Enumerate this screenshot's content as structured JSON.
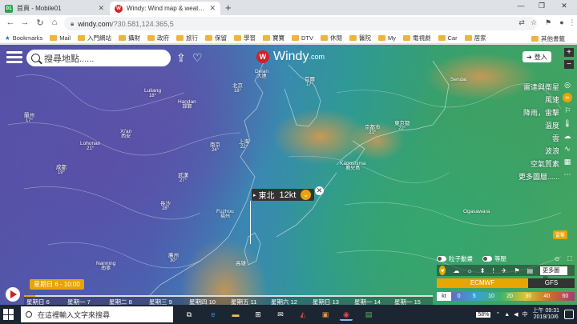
{
  "browser": {
    "tabs": [
      {
        "title": "首頁 - Mobile01",
        "favicon": "mobile01-icon",
        "active": false
      },
      {
        "title": "Windy: Wind map & weather fo",
        "favicon": "windy-icon",
        "active": true
      }
    ],
    "new_tab": "+",
    "url_host": "windy.com",
    "url_path": "/?30.581,124.365,5",
    "bookmarks": [
      "Bookmarks",
      "Mail",
      "入門網站",
      "攝財",
      "政府",
      "旅行",
      "保留",
      "學習",
      "寶寶",
      "DTV",
      "休閒",
      "醫院",
      "My",
      "電視劇",
      "Car",
      "居家"
    ],
    "other_bookmarks": "其他書籤"
  },
  "windy": {
    "search_placeholder": "搜尋地點......",
    "logo_text": "Windy",
    "logo_suffix": ".com",
    "login": "登入",
    "menu": [
      {
        "label": "雷達與衛星",
        "selected": false
      },
      {
        "label": "風速",
        "selected": true
      },
      {
        "label": "降雨，雷擊",
        "selected": false
      },
      {
        "label": "溫度",
        "selected": false
      },
      {
        "label": "雲",
        "selected": false
      },
      {
        "label": "波浪",
        "selected": false
      },
      {
        "label": "空氣質素",
        "selected": false
      },
      {
        "label": "更多圖層......",
        "selected": false
      }
    ],
    "picker": {
      "direction": "東北",
      "value": "12kt"
    },
    "overlay_badge": "雷擊",
    "particles_label": "粒子動畫",
    "isolines_label": "等壓",
    "more_products": "更多圖層......",
    "model_a": "ECMWF",
    "model_b": "GFS",
    "legend_unit": "kt",
    "legend_values": [
      "0",
      "5",
      "10",
      "20",
      "30",
      "40",
      "60"
    ],
    "time_bubble": "星期日 6 - 10:00",
    "timeline_days": [
      "星期日 6",
      "星期一 7",
      "星期二 8",
      "星期三 9",
      "星期四 10",
      "星期五 11",
      "星期六 12",
      "星期日 13",
      "星期一 14",
      "星期一 15"
    ],
    "cities": [
      {
        "name": "Delan",
        "sub": "大連"
      },
      {
        "name": "北京",
        "sub": "18°"
      },
      {
        "name": "Luliang",
        "sub": "18°"
      },
      {
        "name": "Handan",
        "sub": "邯鄲"
      },
      {
        "name": "Lohonan",
        "sub": "21°"
      },
      {
        "name": "蘭州",
        "sub": "17°"
      },
      {
        "name": "Xi'an",
        "sub": "西安"
      },
      {
        "name": "南京",
        "sub": "24°"
      },
      {
        "name": "上海",
        "sub": "22°"
      },
      {
        "name": "Fuzhou",
        "sub": "福州"
      },
      {
        "name": "成都",
        "sub": "19°"
      },
      {
        "name": "武漢",
        "sub": "27°"
      },
      {
        "name": "長沙",
        "sub": "28°"
      },
      {
        "name": "Nanning",
        "sub": "南寧"
      },
      {
        "name": "廣州",
        "sub": "30°"
      },
      {
        "name": "首爾",
        "sub": "17°"
      },
      {
        "name": "京都市",
        "sub": "21°"
      },
      {
        "name": "東京都",
        "sub": "22°"
      },
      {
        "name": "Kagoshima",
        "sub": "鹿兒島"
      },
      {
        "name": "Sendai",
        "sub": ""
      },
      {
        "name": "Ogasawara",
        "sub": ""
      },
      {
        "name": "高雄",
        "sub": ""
      }
    ]
  },
  "taskbar": {
    "search_placeholder": "在這裡輸入文字來搜尋",
    "battery": "58%",
    "ime": "中",
    "time": "上午 09:31",
    "date": "2019/10/6"
  }
}
